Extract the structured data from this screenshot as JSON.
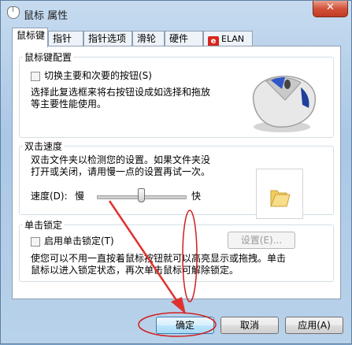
{
  "window": {
    "title": "鼠标 属性",
    "close_glyph": "✕"
  },
  "tabs": [
    {
      "label": "鼠标键"
    },
    {
      "label": "指针"
    },
    {
      "label": "指针选项"
    },
    {
      "label": "滑轮"
    },
    {
      "label": "硬件"
    },
    {
      "label": "ELAN",
      "logo": "e"
    }
  ],
  "button_config": {
    "title": "鼠标键配置",
    "checkbox_label": "切换主要和次要的按钮(S)",
    "description_lines": [
      "选择此复选框来将右按钮设成如选择和拖放",
      "等主要性能使用。"
    ],
    "image": "mouse-image"
  },
  "double_click": {
    "title": "双击速度",
    "description_lines": [
      "双击文件夹以检测您的设置。如果文件夹没",
      "打开或关闭，请用慢一点的设置再试一次。"
    ],
    "speed_label": "速度(D):",
    "slow_label": "慢",
    "fast_label": "快",
    "slider_level_fraction": 0.5,
    "test_icon": "folder-icon"
  },
  "click_lock": {
    "title": "单击锁定",
    "checkbox_label": "启用单击锁定(T)",
    "settings_button": "设置(E)...",
    "description_lines": [
      "使您可以不用一直按着鼠标按钮就可以高亮显示或拖拽。单击",
      "鼠标以进入锁定状态，再次单击鼠标可解除锁定。"
    ]
  },
  "footer": {
    "ok_label": "确定",
    "cancel_label": "取消",
    "apply_label": "应用(A)"
  },
  "annotations": {
    "arrow_color": "#e03131",
    "highlight_color": "#d02020"
  }
}
